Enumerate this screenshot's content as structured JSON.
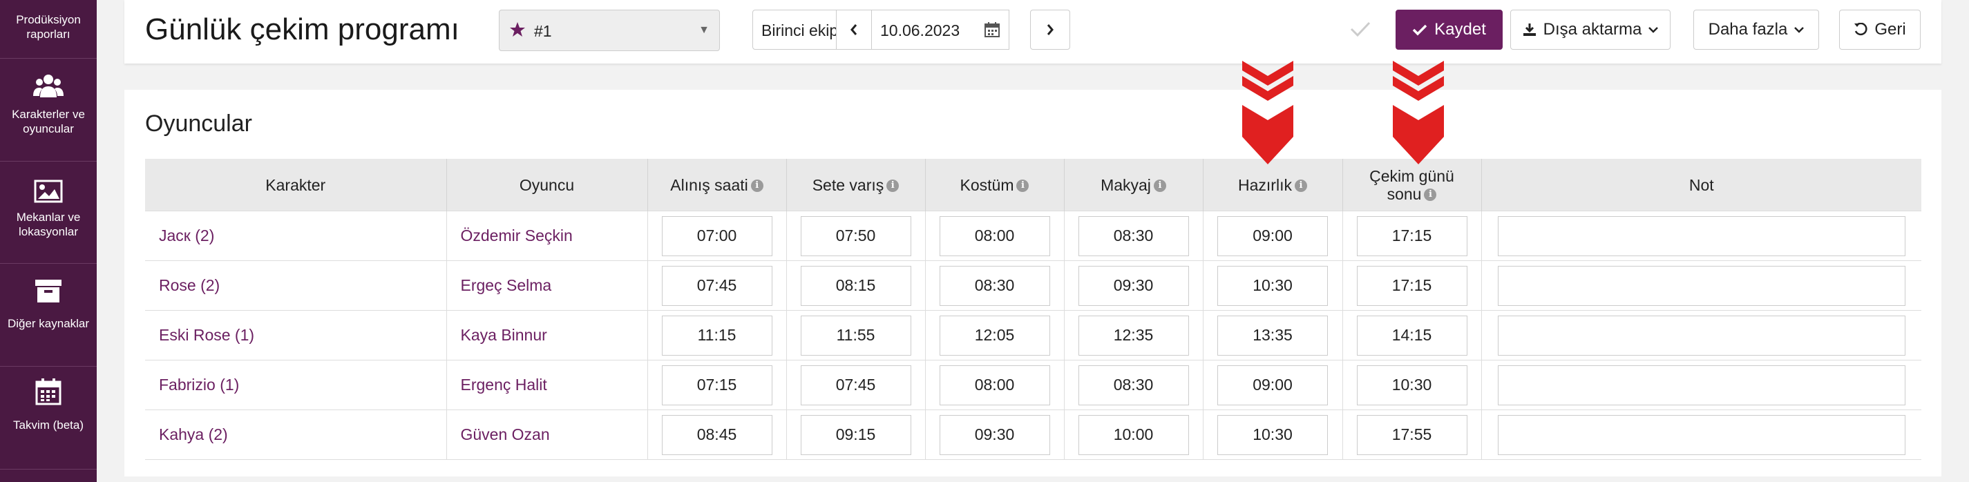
{
  "sidebar": {
    "items": [
      {
        "label": "Prodüksiyon raporları",
        "icon": "report-icon"
      },
      {
        "label": "Karakterler ve oyuncular",
        "icon": "users-icon"
      },
      {
        "label": "Mekanlar ve lokasyonlar",
        "icon": "image-icon"
      },
      {
        "label": "Diğer kaynaklar",
        "icon": "archive-icon"
      },
      {
        "label": "Takvim (beta)",
        "icon": "calendar-icon"
      }
    ]
  },
  "header": {
    "title": "Günlük çekim programı",
    "schedule_select": "#1",
    "unit": "Birinci ekip",
    "date": "10.06.2023",
    "save_label": "Kaydet",
    "export_label": "Dışa aktarma",
    "more_label": "Daha fazla",
    "back_label": "Geri"
  },
  "panel": {
    "title": "Oyuncular",
    "columns": [
      "Karakter",
      "Oyuncu",
      "Alınış saati",
      "Sete varış",
      "Kostüm",
      "Makyaj",
      "Hazırlık",
      "Çekim günü sonu",
      "Not"
    ],
    "rows": [
      {
        "character": "Jacк (2)",
        "actor": "Özdemir Seçkin",
        "pickup": "07:00",
        "on_set": "07:50",
        "costume": "08:00",
        "makeup": "08:30",
        "ready": "09:00",
        "wrap": "17:15",
        "note": ""
      },
      {
        "character": "Rose (2)",
        "actor": "Ergeç Selma",
        "pickup": "07:45",
        "on_set": "08:15",
        "costume": "08:30",
        "makeup": "09:30",
        "ready": "10:30",
        "wrap": "17:15",
        "note": ""
      },
      {
        "character": "Eski Rose (1)",
        "actor": "Kaya Binnur",
        "pickup": "11:15",
        "on_set": "11:55",
        "costume": "12:05",
        "makeup": "12:35",
        "ready": "13:35",
        "wrap": "14:15",
        "note": ""
      },
      {
        "character": "Fabrizio (1)",
        "actor": "Ergenç Halit",
        "pickup": "07:15",
        "on_set": "07:45",
        "costume": "08:00",
        "makeup": "08:30",
        "ready": "09:00",
        "wrap": "10:30",
        "note": ""
      },
      {
        "character": "Kahya (2)",
        "actor": "Güven Ozan",
        "pickup": "08:45",
        "on_set": "09:15",
        "costume": "09:30",
        "makeup": "10:00",
        "ready": "10:30",
        "wrap": "17:55",
        "note": ""
      }
    ]
  },
  "colors": {
    "brand": "#4a1942",
    "accent": "#6b1f61",
    "annotation_arrow": "#e02020"
  }
}
